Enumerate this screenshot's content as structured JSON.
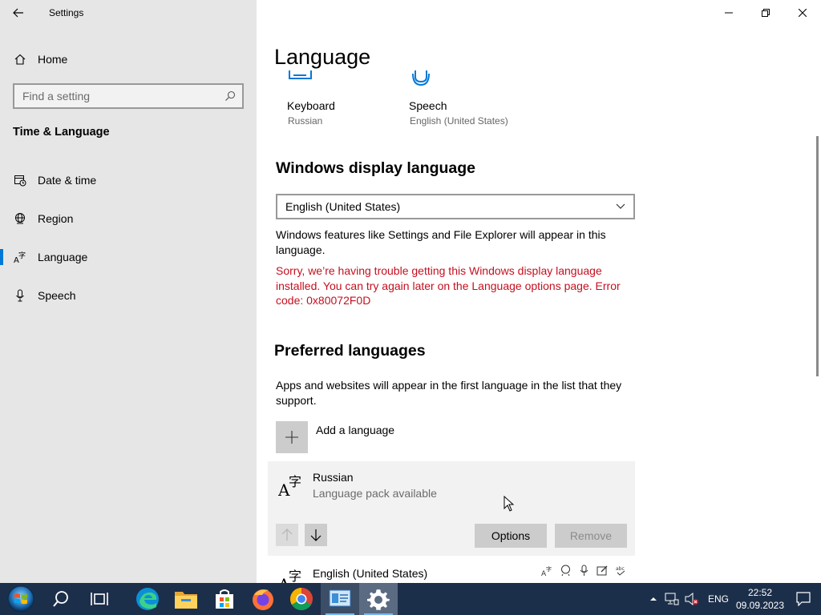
{
  "window": {
    "title": "Settings"
  },
  "sidebar": {
    "home_label": "Home",
    "search_placeholder": "Find a setting",
    "section_heading": "Time & Language",
    "items": [
      {
        "label": "Date & time",
        "icon": "date-time-icon"
      },
      {
        "label": "Region",
        "icon": "region-icon"
      },
      {
        "label": "Language",
        "icon": "language-icon",
        "active": true
      },
      {
        "label": "Speech",
        "icon": "microphone-icon"
      }
    ]
  },
  "main": {
    "page_title": "Language",
    "tiles": [
      {
        "title": "Keyboard",
        "subtitle": "Russian",
        "icon": "keyboard-icon"
      },
      {
        "title": "Speech",
        "subtitle": "English (United States)",
        "icon": "speech-icon"
      }
    ],
    "display_language": {
      "heading": "Windows display language",
      "selected": "English (United States)",
      "description": "Windows features like Settings and File Explorer will appear in this language.",
      "error": "Sorry, we’re having trouble getting this Windows display language installed. You can try again later on the Language options page. Error code: 0x80072F0D"
    },
    "preferred": {
      "heading": "Preferred languages",
      "description": "Apps and websites will appear in the first language in the list that they support.",
      "add_label": "Add a language",
      "languages": [
        {
          "name": "Russian",
          "status": "Language pack available"
        },
        {
          "name": "English (United States)",
          "status": ""
        }
      ],
      "options_label": "Options",
      "remove_label": "Remove"
    }
  },
  "taskbar": {
    "apps": [
      "start-icon",
      "search-icon",
      "task-view-icon",
      "edge-icon",
      "file-explorer-icon",
      "store-icon",
      "firefox-icon",
      "chrome-icon",
      "control-panel-icon",
      "settings-icon"
    ],
    "tray": {
      "input_language": "ENG",
      "time": "22:52",
      "date": "09.09.2023"
    }
  },
  "colors": {
    "accent": "#0078d7",
    "error": "#c50f1f",
    "sidebar_bg": "#e6e6e6",
    "taskbar_bg": "#1c2f4a"
  }
}
